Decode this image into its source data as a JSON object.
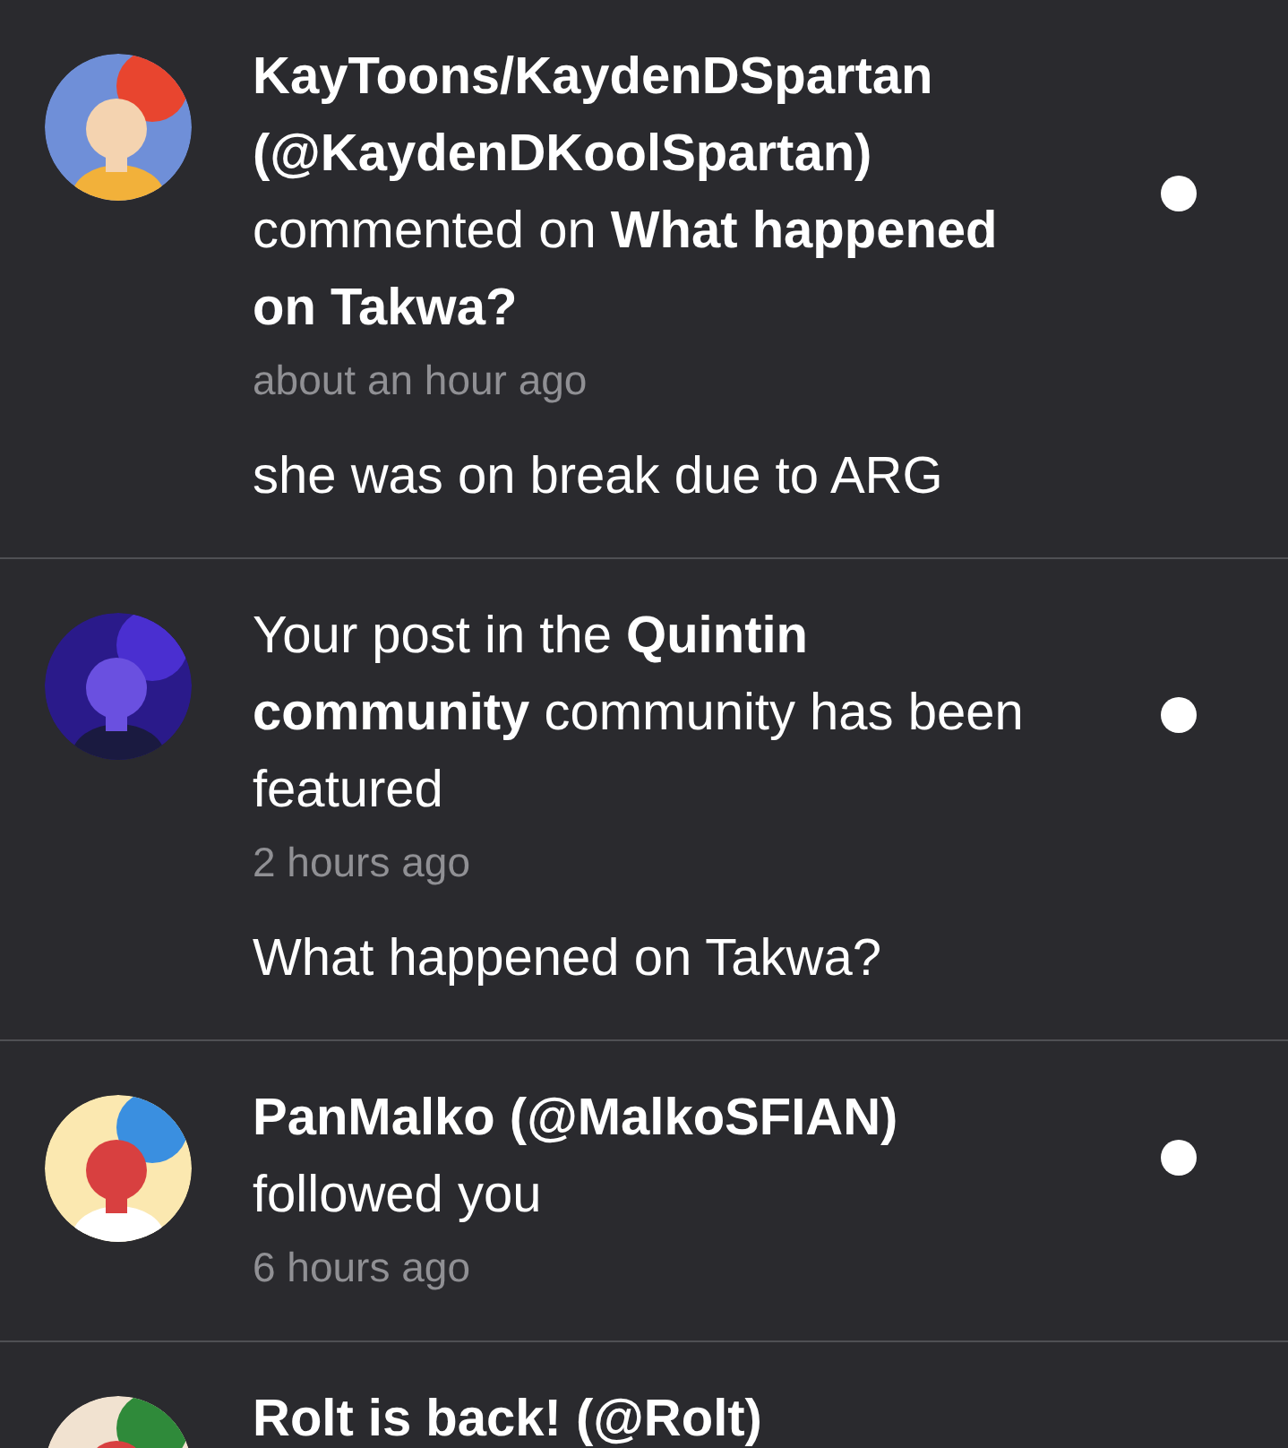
{
  "notifications": [
    {
      "header": "**KayToons/KaydenDSpartan (@KaydenDKoolSpartan)** commented on **What happened on Takwa?**",
      "time": "about an hour ago",
      "comment": "she was on break due to ARG",
      "unread": true
    },
    {
      "header": "Your post in the **Quintin community** community has been featured",
      "time": "2 hours ago",
      "comment": "What happened on Takwa?",
      "unread": true
    },
    {
      "header": "**PanMalko (@MalkoSFIAN)** followed you",
      "time": "6 hours ago",
      "unread": true
    },
    {
      "header": "**Rolt is back! (@Rolt)**"
    }
  ]
}
